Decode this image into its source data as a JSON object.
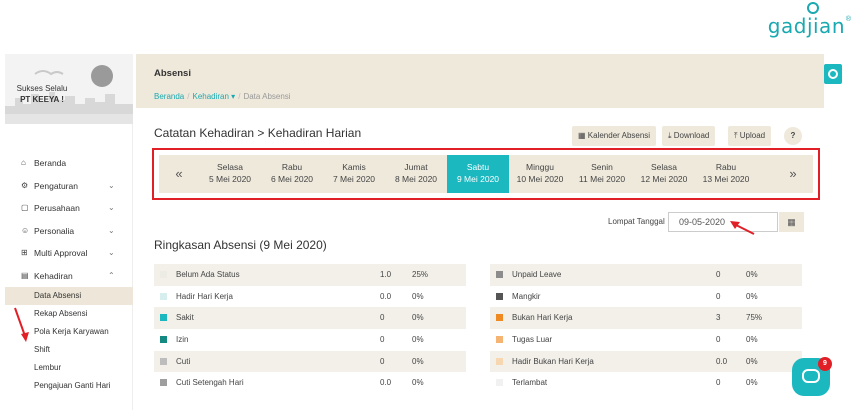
{
  "brand": {
    "logo_text": "gadjian",
    "logo_mark": "®"
  },
  "company": {
    "tagline": "Sukses Selalu",
    "name": "PT KEEYA !"
  },
  "sidebar": {
    "items": [
      {
        "icon": "home-icon",
        "glyph": "⌂",
        "label": "Beranda",
        "chevron": ""
      },
      {
        "icon": "gears-icon",
        "glyph": "⚙",
        "label": "Pengaturan",
        "chevron": "⌄"
      },
      {
        "icon": "folder-icon",
        "glyph": "▢",
        "label": "Perusahaan",
        "chevron": "⌄"
      },
      {
        "icon": "smile-icon",
        "glyph": "☺",
        "label": "Personalia",
        "chevron": "⌄"
      },
      {
        "icon": "sitemap-icon",
        "glyph": "⊞",
        "label": "Multi Approval",
        "chevron": "⌄"
      },
      {
        "icon": "book-icon",
        "glyph": "▤",
        "label": "Kehadiran",
        "chevron": "⌃"
      }
    ],
    "subitems": [
      {
        "label": "Data Absensi",
        "active": true
      },
      {
        "label": "Rekap Absensi",
        "active": false
      },
      {
        "label": "Pola Kerja Karyawan",
        "active": false
      },
      {
        "label": "Shift",
        "active": false
      },
      {
        "label": "Lembur",
        "active": false
      },
      {
        "label": "Pengajuan Ganti Hari",
        "active": false
      }
    ]
  },
  "header": {
    "section": "Absensi",
    "breadcrumb": [
      "Beranda",
      "Kehadiran ▾",
      "Data Absensi"
    ]
  },
  "page": {
    "title": "Catatan Kehadiran > Kehadiran Harian",
    "btn_calendar": "Kalender Absensi",
    "btn_download": "Download",
    "btn_upload": "Upload",
    "btn_help": "?"
  },
  "days": {
    "prev": "«",
    "next": "»",
    "list": [
      {
        "day": "Selasa",
        "date": "5 Mei 2020",
        "selected": false
      },
      {
        "day": "Rabu",
        "date": "6 Mei 2020",
        "selected": false
      },
      {
        "day": "Kamis",
        "date": "7 Mei 2020",
        "selected": false
      },
      {
        "day": "Jumat",
        "date": "8 Mei 2020",
        "selected": false
      },
      {
        "day": "Sabtu",
        "date": "9 Mei 2020",
        "selected": true
      },
      {
        "day": "Minggu",
        "date": "10 Mei 2020",
        "selected": false
      },
      {
        "day": "Senin",
        "date": "11 Mei 2020",
        "selected": false
      },
      {
        "day": "Selasa",
        "date": "12 Mei 2020",
        "selected": false
      },
      {
        "day": "Rabu",
        "date": "13 Mei 2020",
        "selected": false
      }
    ]
  },
  "jump": {
    "label": "Lompat Tanggal",
    "value": "09-05-2020"
  },
  "summary": {
    "title": "Ringkasan Absensi (9 Mei 2020)",
    "left": [
      {
        "name": "Belum Ada Status",
        "count": "1.0",
        "pct": "25%",
        "color": "#ecebe4"
      },
      {
        "name": "Hadir Hari Kerja",
        "count": "0.0",
        "pct": "0%",
        "color": "#d6eeee"
      },
      {
        "name": "Sakit",
        "count": "0",
        "pct": "0%",
        "color": "#1bb8c0"
      },
      {
        "name": "Izin",
        "count": "0",
        "pct": "0%",
        "color": "#148a82"
      },
      {
        "name": "Cuti",
        "count": "0",
        "pct": "0%",
        "color": "#bdbdbd"
      },
      {
        "name": "Cuti Setengah Hari",
        "count": "0.0",
        "pct": "0%",
        "color": "#9e9e9e"
      }
    ],
    "right": [
      {
        "name": "Unpaid Leave",
        "count": "0",
        "pct": "0%",
        "color": "#8c8c8c"
      },
      {
        "name": "Mangkir",
        "count": "0",
        "pct": "0%",
        "color": "#555555"
      },
      {
        "name": "Bukan Hari Kerja",
        "count": "3",
        "pct": "75%",
        "color": "#ef8a22"
      },
      {
        "name": "Tugas Luar",
        "count": "0",
        "pct": "0%",
        "color": "#f5b472"
      },
      {
        "name": "Hadir Bukan Hari Kerja",
        "count": "0.0",
        "pct": "0%",
        "color": "#f7d6b2"
      },
      {
        "name": "Terlambat",
        "count": "0",
        "pct": "0%",
        "color": "#f1f1f1"
      }
    ]
  },
  "chat": {
    "badge": "9"
  }
}
